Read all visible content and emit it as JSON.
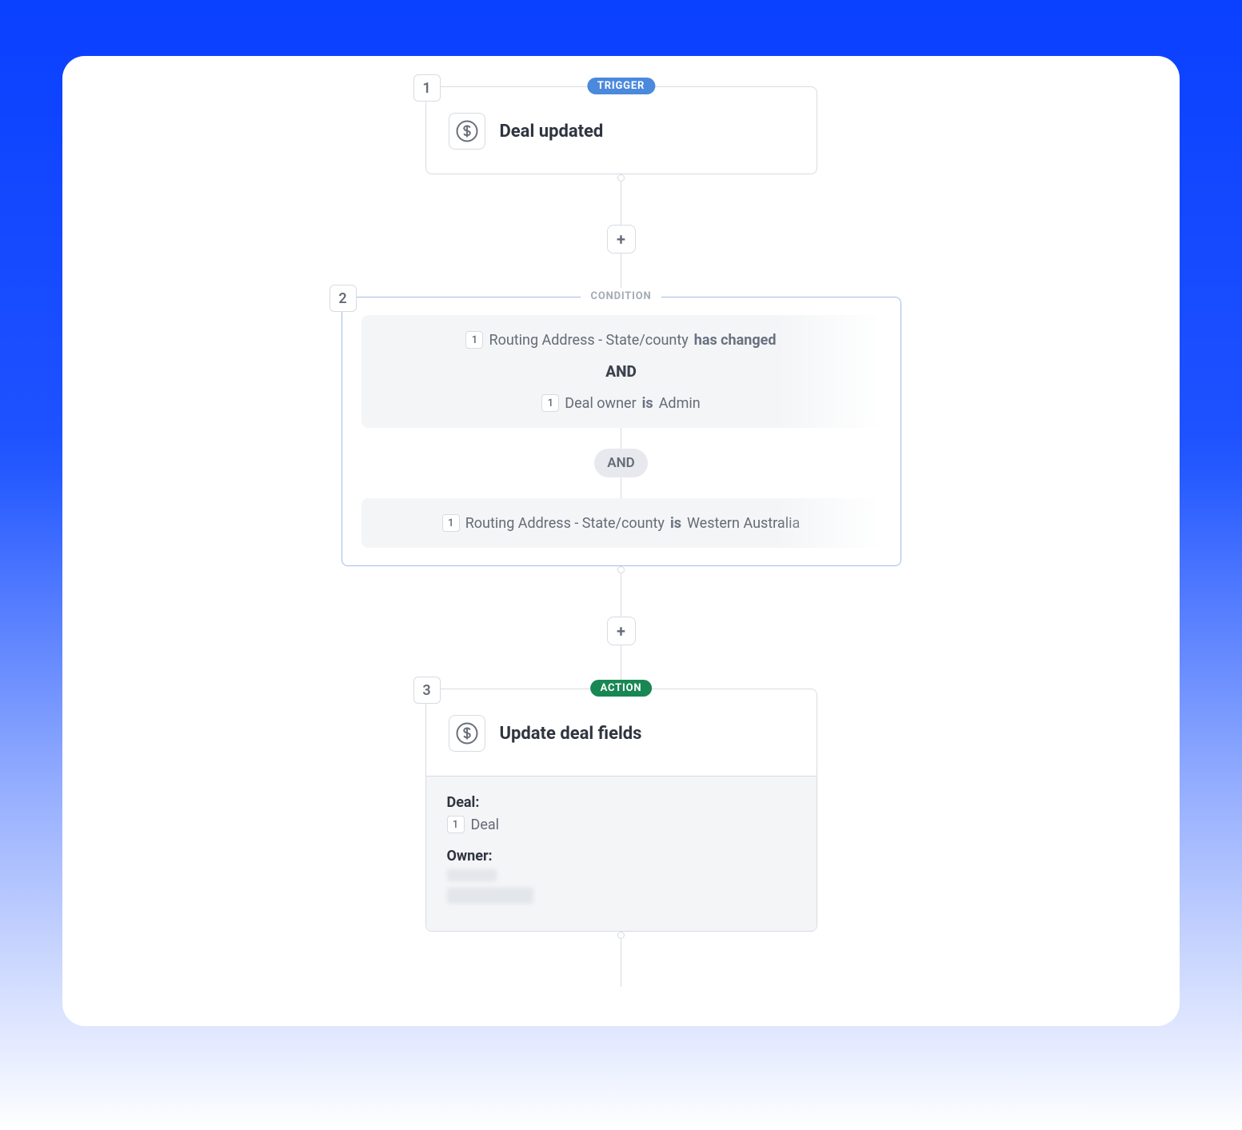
{
  "nodes": {
    "trigger": {
      "num": "1",
      "tag": "TRIGGER",
      "title": "Deal updated",
      "icon": "dollar-icon"
    },
    "condition": {
      "num": "2",
      "tag": "CONDITION",
      "group1": {
        "line1": {
          "ref": "1",
          "field": "Routing Address - State/county",
          "op": "has changed"
        },
        "join": "AND",
        "line2": {
          "ref": "1",
          "field": "Deal owner",
          "op": "is",
          "value": "Admin"
        }
      },
      "between": "AND",
      "group2": {
        "line1": {
          "ref": "1",
          "field": "Routing Address - State/county",
          "op": "is",
          "value": "Western Australia"
        }
      }
    },
    "action": {
      "num": "3",
      "tag": "ACTION",
      "title": "Update deal fields",
      "icon": "dollar-icon",
      "deal": {
        "label": "Deal:",
        "ref": "1",
        "value": "Deal"
      },
      "owner": {
        "label": "Owner:"
      }
    }
  },
  "glyphs": {
    "plus": "+"
  }
}
